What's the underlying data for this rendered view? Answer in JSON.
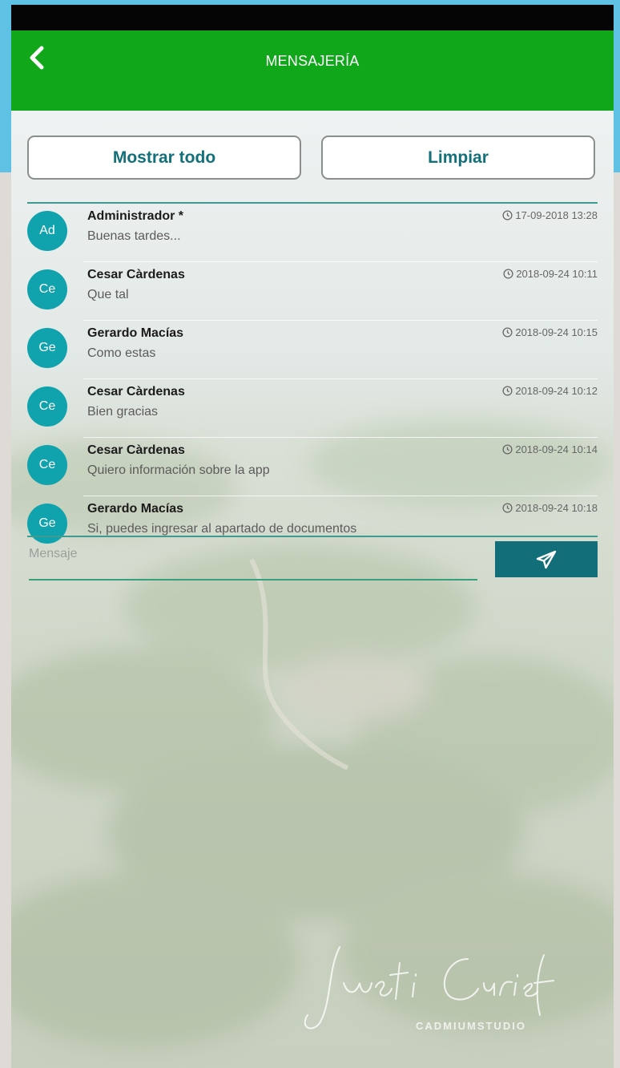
{
  "app_bar": {
    "title": "MENSAJERÍA",
    "back_icon": "chevron-left-icon"
  },
  "actions": {
    "show_all": "Mostrar todo",
    "clear": "Limpiar"
  },
  "messages": [
    {
      "initials": "Ad",
      "sender": "Administrador *",
      "text": "Buenas tardes...",
      "time": "17-09-2018 13:28"
    },
    {
      "initials": "Ce",
      "sender": "Cesar Càrdenas",
      "text": "Que tal",
      "time": "2018-09-24 10:11"
    },
    {
      "initials": "Ge",
      "sender": "Gerardo Macías",
      "text": "Como estas",
      "time": "2018-09-24 10:15"
    },
    {
      "initials": "Ce",
      "sender": "Cesar Càrdenas",
      "text": "Bien gracias",
      "time": "2018-09-24 10:12"
    },
    {
      "initials": "Ce",
      "sender": "Cesar Càrdenas",
      "text": "Quiero información sobre la app",
      "time": "2018-09-24 10:14"
    },
    {
      "initials": "Ge",
      "sender": "Gerardo Macías",
      "text": "Si, puedes ingresar al apartado de documentos",
      "time": "2018-09-24 10:18"
    }
  ],
  "composer": {
    "placeholder": "Mensaje",
    "send_icon": "paper-plane-icon"
  },
  "watermark": {
    "studio": "CADMIUMSTUDIO"
  },
  "colors": {
    "app_bar": "#10a81a",
    "status_bar": "#050505",
    "accent_teal": "#12707a",
    "avatar": "#11a3ad",
    "send_button": "#126e79",
    "frame": "#5fc2e4"
  }
}
